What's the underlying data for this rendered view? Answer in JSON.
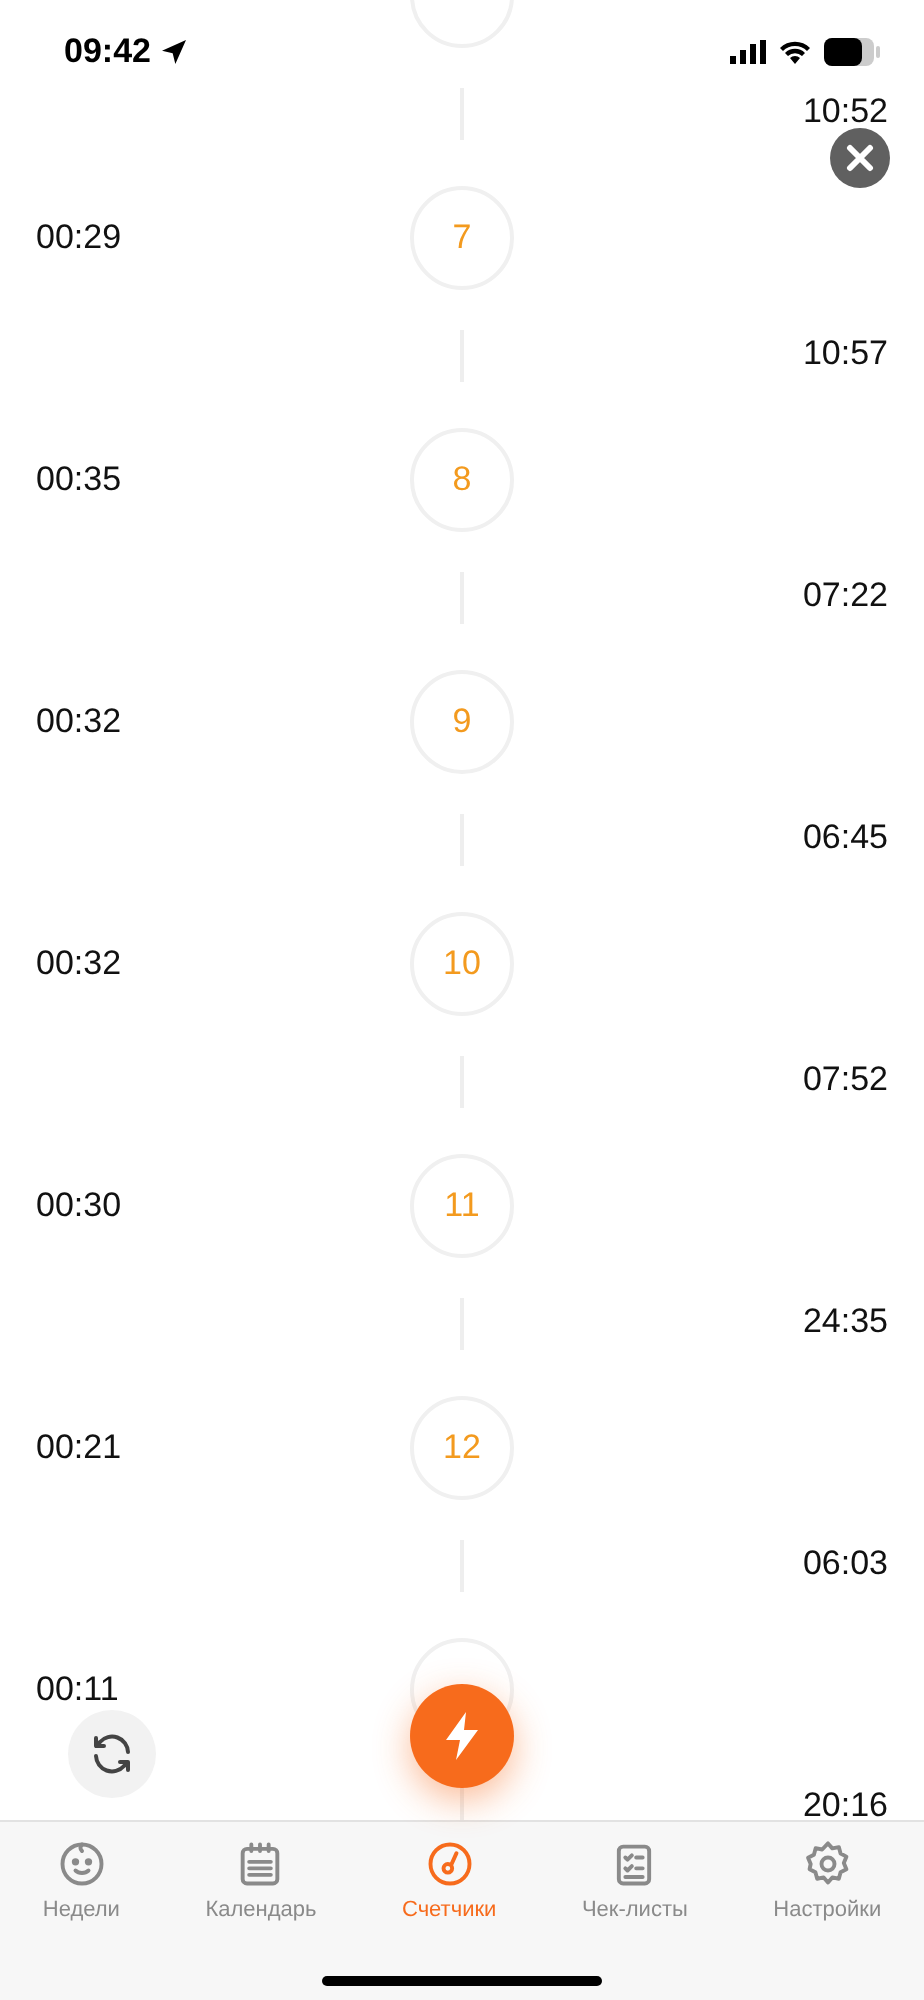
{
  "status_bar": {
    "time": "09:42"
  },
  "timeline": [
    {
      "gap_time": "10:52"
    },
    {
      "number": "7",
      "duration": "00:29",
      "gap_time": "10:57"
    },
    {
      "number": "8",
      "duration": "00:35",
      "gap_time": "07:22"
    },
    {
      "number": "9",
      "duration": "00:32",
      "gap_time": "06:45"
    },
    {
      "number": "10",
      "duration": "00:32",
      "gap_time": "07:52"
    },
    {
      "number": "11",
      "duration": "00:30",
      "gap_time": "24:35"
    },
    {
      "number": "12",
      "duration": "00:21",
      "gap_time": "06:03"
    },
    {
      "duration": "00:11",
      "gap_time": "20:16"
    }
  ],
  "tabs": [
    {
      "kind": "baby",
      "label": "Недели",
      "selected": false
    },
    {
      "kind": "calendar",
      "label": "Календарь",
      "selected": false
    },
    {
      "kind": "gauge",
      "label": "Счетчики",
      "selected": true
    },
    {
      "kind": "checklist",
      "label": "Чек-листы",
      "selected": false
    },
    {
      "kind": "gear",
      "label": "Настройки",
      "selected": false
    }
  ]
}
